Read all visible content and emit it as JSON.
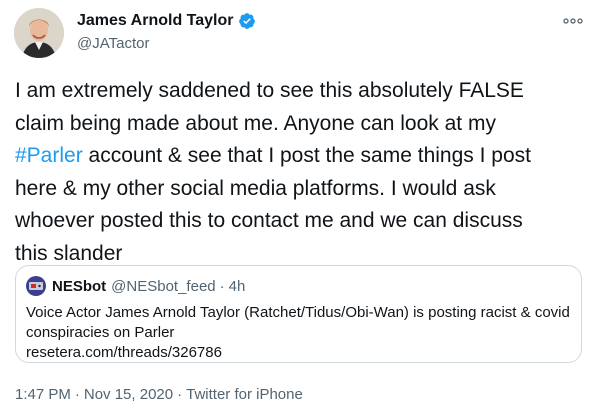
{
  "author": {
    "display_name": "James Arnold Taylor",
    "handle": "@JATactor",
    "verified": true,
    "avatar_icon": "profile-photo"
  },
  "tweet": {
    "line1": "I am extremely saddened to see this absolutely FALSE",
    "line2": "claim being made about me. Anyone can look at my",
    "hashtag": "#Parler",
    "line3_rest": " account & see that I post the same things I post",
    "line4": "here & my other social media platforms. I would ask",
    "line5": "whoever posted this to contact me and we can discuss",
    "line6": "this slander"
  },
  "quote": {
    "display_name": "NESbot",
    "handle": "@NESbot_feed",
    "separator": "·",
    "time": "4h",
    "line1": "Voice Actor James Arnold Taylor (Ratchet/Tidus/Obi-Wan) is posting racist & covid",
    "line2": "conspiracies on Parler",
    "link": "resetera.com/threads/326786"
  },
  "meta": {
    "time": "1:47 PM",
    "separator": "·",
    "date": "Nov 15, 2020",
    "source": "Twitter for iPhone"
  },
  "colors": {
    "accent": "#1d9bf0",
    "secondary_text": "#536471",
    "border": "#cfd9de"
  }
}
